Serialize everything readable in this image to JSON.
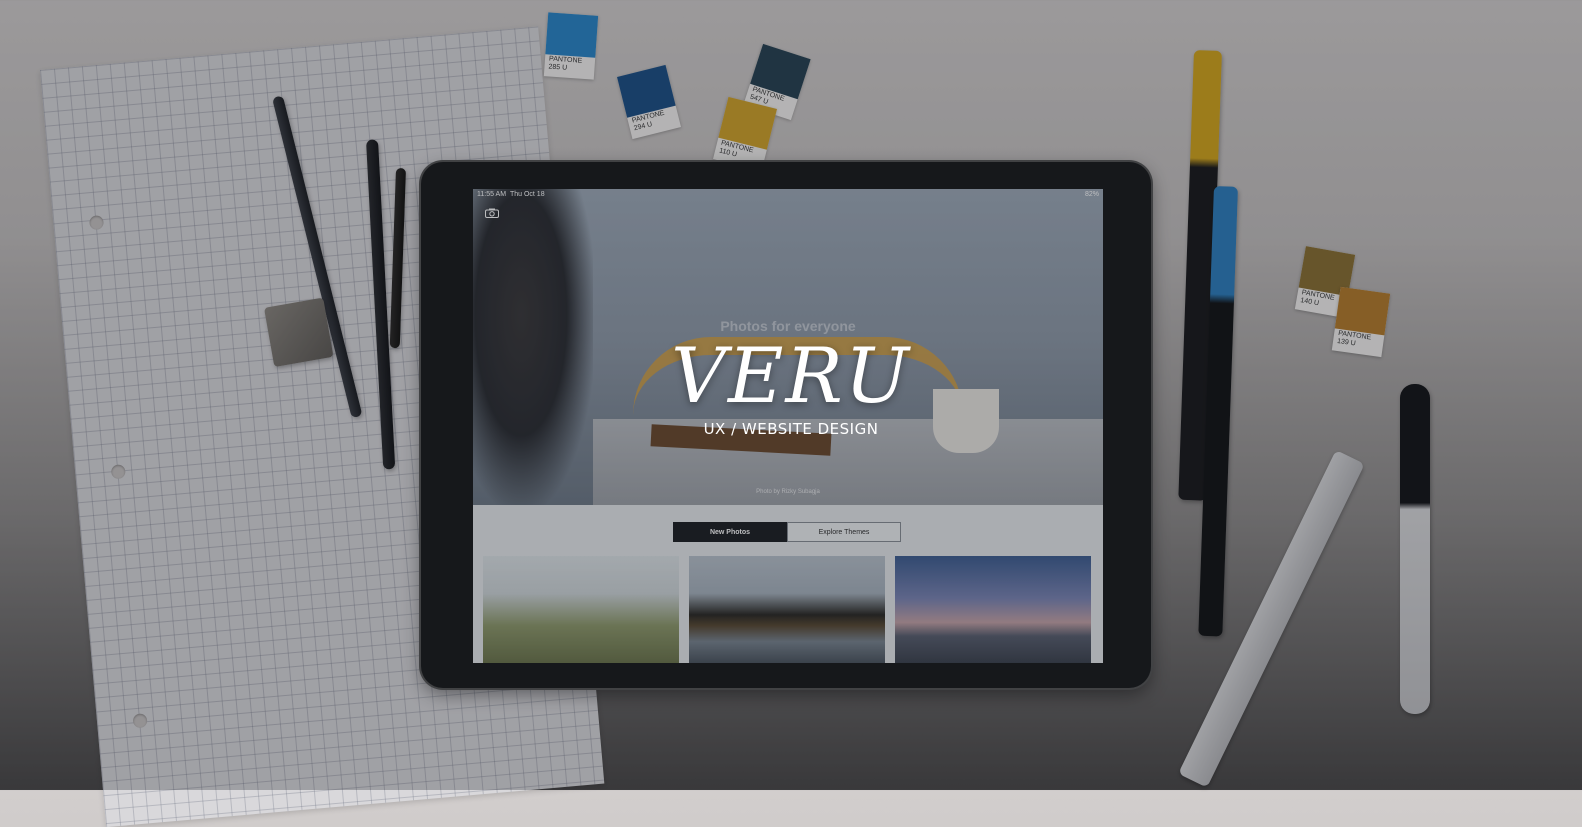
{
  "tablet_screen": {
    "status_time": "11:55 AM",
    "status_date": "Thu Oct 18",
    "status_battery": "82%",
    "hero_tagline": "Photos for everyone",
    "photo_credit": "Photo by Rizky Subagja",
    "tabs": [
      {
        "label": "New Photos",
        "active": true
      },
      {
        "label": "Explore Themes",
        "active": false
      }
    ]
  },
  "swatches": [
    {
      "label": "PANTONE 285 U",
      "color": "#2a86c8"
    },
    {
      "label": "PANTONE 294 U",
      "color": "#1d4f86"
    },
    {
      "label": "PANTONE 547 U",
      "color": "#274252"
    },
    {
      "label": "PANTONE 110 U",
      "color": "#d0a22a"
    },
    {
      "label": "PANTONE 140 U",
      "color": "#8a6f32"
    },
    {
      "label": "PANTONE 139 U",
      "color": "#b57c2c"
    }
  ],
  "brand": {
    "title": "VERU",
    "subtitle": "UX / WEBSITE DESIGN"
  },
  "colors": {
    "tablet_bezel": "#1a1b1d",
    "tab_active": "#1e2024"
  }
}
